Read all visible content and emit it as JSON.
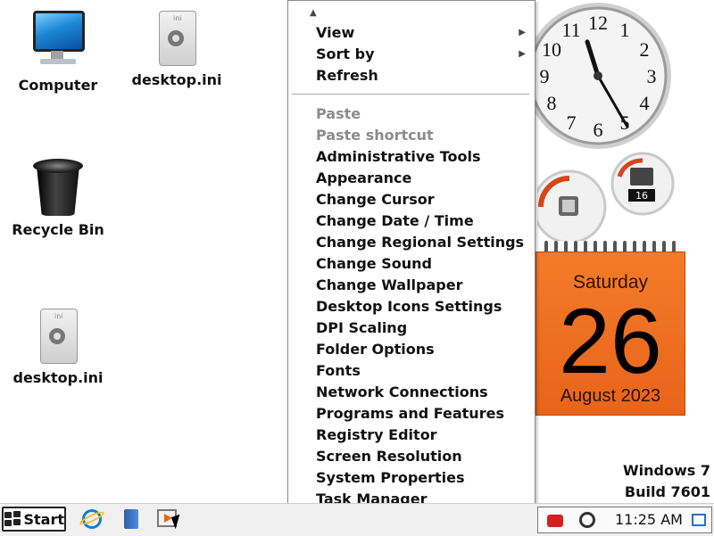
{
  "desktop": {
    "icons": [
      {
        "label": "Computer",
        "icon": "computer-icon"
      },
      {
        "label": "desktop.ini",
        "icon": "ini-file-icon"
      },
      {
        "label": "Recycle Bin",
        "icon": "recycle-bin-icon"
      },
      {
        "label": "desktop.ini",
        "icon": "ini-file-icon"
      }
    ]
  },
  "context_menu": {
    "top_items": [
      {
        "label": "View",
        "has_submenu": true
      },
      {
        "label": "Sort by",
        "has_submenu": true
      },
      {
        "label": "Refresh",
        "has_submenu": false
      }
    ],
    "items": [
      {
        "label": "Paste",
        "disabled": true
      },
      {
        "label": "Paste shortcut",
        "disabled": true
      },
      {
        "label": "Administrative Tools",
        "disabled": false
      },
      {
        "label": "Appearance",
        "disabled": false
      },
      {
        "label": "Change Cursor",
        "disabled": false
      },
      {
        "label": "Change Date / Time",
        "disabled": false
      },
      {
        "label": "Change Regional Settings",
        "disabled": false
      },
      {
        "label": "Change Sound",
        "disabled": false
      },
      {
        "label": "Change Wallpaper",
        "disabled": false
      },
      {
        "label": "Desktop Icons Settings",
        "disabled": false
      },
      {
        "label": "DPI Scaling",
        "disabled": false
      },
      {
        "label": "Folder Options",
        "disabled": false
      },
      {
        "label": "Fonts",
        "disabled": false
      },
      {
        "label": "Network Connections",
        "disabled": false
      },
      {
        "label": "Programs and Features",
        "disabled": false
      },
      {
        "label": "Registry Editor",
        "disabled": false
      },
      {
        "label": "Screen Resolution",
        "disabled": false
      },
      {
        "label": "System Properties",
        "disabled": false
      },
      {
        "label": "Task Manager",
        "disabled": false
      }
    ]
  },
  "gadgets": {
    "clock": {
      "hour": 11,
      "minute": 25,
      "numerals": [
        "12",
        "1",
        "2",
        "3",
        "4",
        "5",
        "6",
        "7",
        "8",
        "9",
        "10",
        "11"
      ]
    },
    "meter": {
      "readout": "16"
    },
    "calendar": {
      "day_name": "Saturday",
      "date": "26",
      "month_year": "August 2023"
    }
  },
  "os_watermark": {
    "line1": "Windows 7",
    "line2": "Build 7601"
  },
  "taskbar": {
    "start_label": "Start",
    "pinned": [
      "internet-explorer-icon",
      "book-icon",
      "media-player-icon"
    ],
    "tray_time": "11:25 AM"
  },
  "colors": {
    "calendar_orange": "#e8641a",
    "menu_disabled": "#8c8c8c",
    "accent_blue": "#1b7ad4"
  }
}
